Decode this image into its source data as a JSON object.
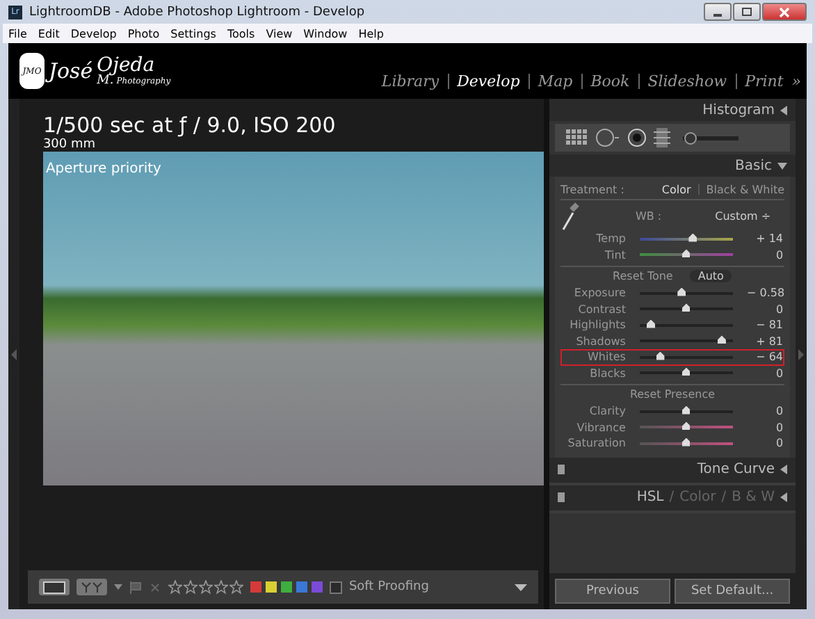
{
  "window": {
    "app_icon": "Lr",
    "title": "LightroomDB - Adobe Photoshop Lightroom - Develop"
  },
  "tool_strip": {
    "brush_size": {
      "level": 0.03
    }
  },
  "menu": [
    "File",
    "Edit",
    "Develop",
    "Photo",
    "Settings",
    "Tools",
    "View",
    "Window",
    "Help"
  ],
  "identity": {
    "name": "José",
    "surname": "Ojeda",
    "initials": "M.",
    "tagline": "Photography",
    "badge": "JMO"
  },
  "modules": [
    {
      "label": "Library",
      "selected": false
    },
    {
      "label": "Develop",
      "selected": true
    },
    {
      "label": "Map",
      "selected": false
    },
    {
      "label": "Book",
      "selected": false
    },
    {
      "label": "Slideshow",
      "selected": false
    },
    {
      "label": "Print",
      "selected": false
    }
  ],
  "more_modules": "»",
  "photo_info": {
    "exposure": "1/500 sec at ƒ / 9.0, ISO 200",
    "focal_length": "300 mm",
    "mode": "Aperture priority"
  },
  "toolbar": {
    "stars": 0,
    "labels": [
      {
        "color": "#d63a3a"
      },
      {
        "color": "#d8d032"
      },
      {
        "color": "#3fae3f"
      },
      {
        "color": "#3a78d8"
      },
      {
        "color": "#7a4ad8"
      }
    ],
    "soft_proofing": {
      "label": "Soft Proofing",
      "checked": false
    }
  },
  "panels": {
    "histogram": "Histogram",
    "basic": "Basic",
    "treatment": {
      "label": "Treatment :",
      "options": [
        {
          "label": "Color",
          "selected": true
        },
        {
          "label": "Black & White",
          "selected": false
        }
      ]
    },
    "wb": {
      "label": "WB :",
      "value": "Custom ÷"
    },
    "wb_sliders": [
      {
        "name": "Temp",
        "kind": "temp",
        "level": 0.57,
        "reading": "+ 14",
        "highlighted": false
      },
      {
        "name": "Tint",
        "kind": "tint",
        "level": 0.5,
        "reading": "0",
        "highlighted": false
      }
    ],
    "tone": {
      "reset": "Reset Tone",
      "auto": "Auto"
    },
    "tone_sliders": [
      {
        "name": "Exposure",
        "kind": "plain",
        "level": 0.45,
        "reading": "− 0.58",
        "highlighted": false
      },
      {
        "name": "Contrast",
        "kind": "plain",
        "level": 0.5,
        "reading": "0",
        "highlighted": false
      },
      {
        "name": "Highlights",
        "kind": "plain",
        "level": 0.12,
        "reading": "− 81",
        "highlighted": false
      },
      {
        "name": "Shadows",
        "kind": "plain",
        "level": 0.88,
        "reading": "+ 81",
        "highlighted": false
      },
      {
        "name": "Whites",
        "kind": "plain",
        "level": 0.22,
        "reading": "− 64",
        "highlighted": true
      },
      {
        "name": "Blacks",
        "kind": "plain",
        "level": 0.5,
        "reading": "0",
        "highlighted": false
      }
    ],
    "presence": {
      "reset": "Reset Presence"
    },
    "presence_sliders": [
      {
        "name": "Clarity",
        "kind": "plain",
        "level": 0.5,
        "reading": "0",
        "highlighted": false
      },
      {
        "name": "Vibrance",
        "kind": "color",
        "level": 0.5,
        "reading": "0",
        "highlighted": false
      },
      {
        "name": "Saturation",
        "kind": "color",
        "level": 0.5,
        "reading": "0",
        "highlighted": false
      }
    ],
    "tone_curve": "Tone Curve",
    "hsl": [
      "HSL",
      "Color",
      "B & W"
    ],
    "separator": "/",
    "buttons": [
      "Previous",
      "Set Default..."
    ]
  }
}
